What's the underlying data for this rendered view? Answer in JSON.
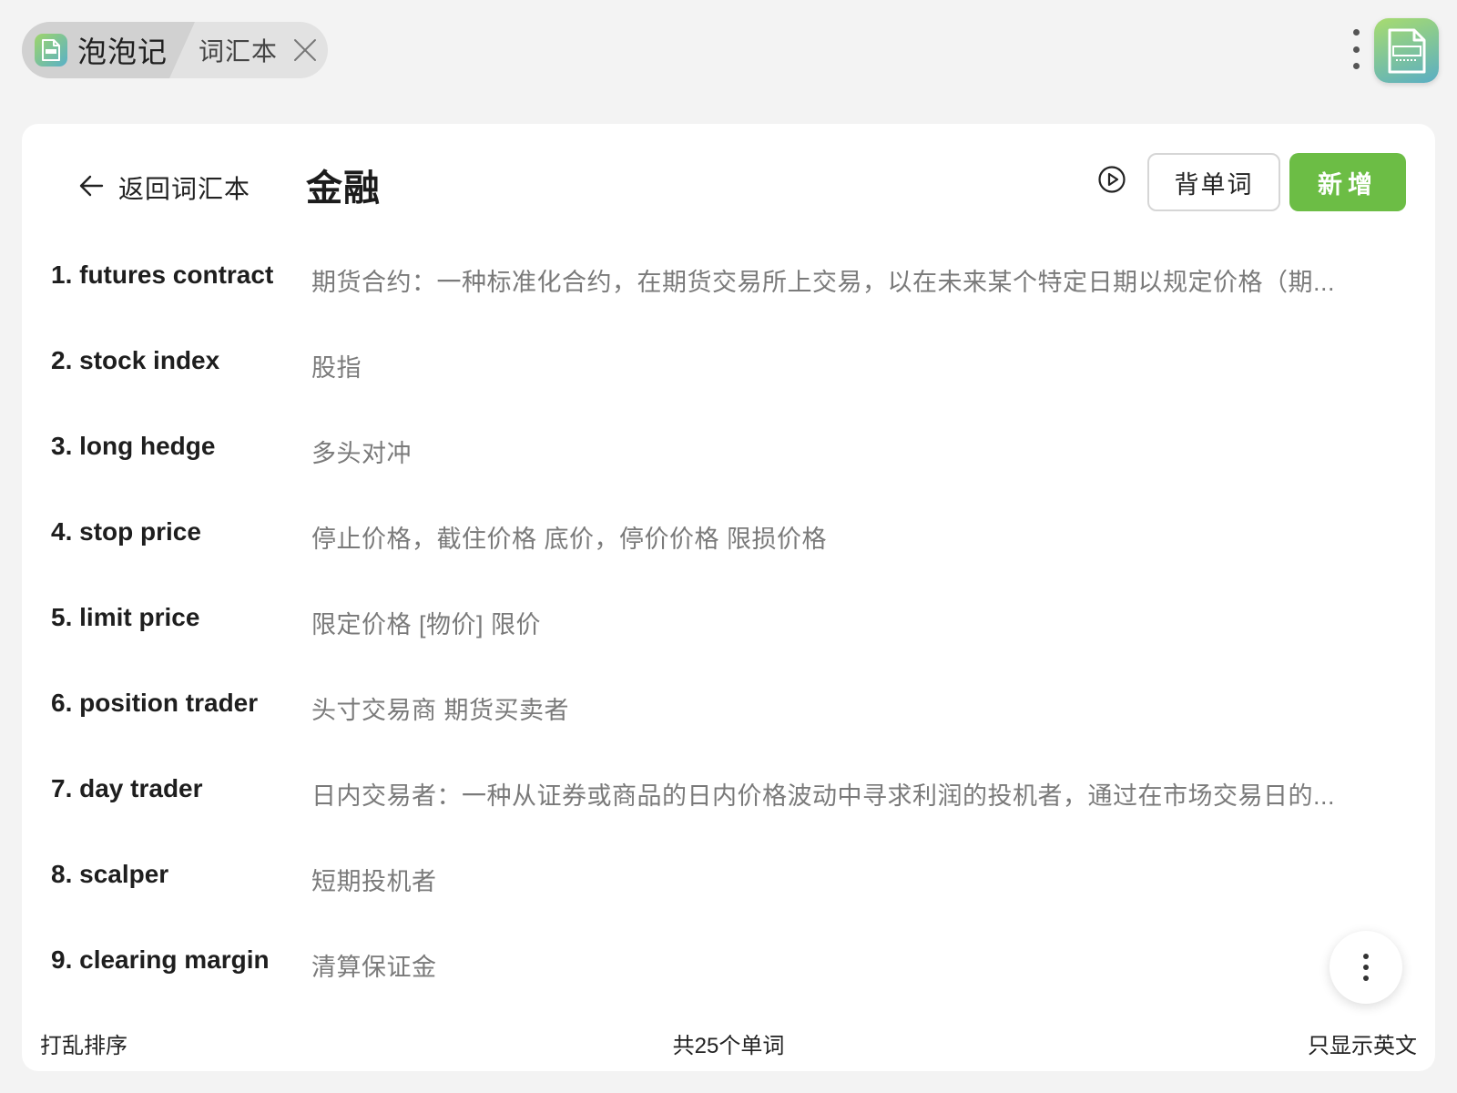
{
  "tabs": {
    "home_label": "泡泡记",
    "vocab_label": "词汇本"
  },
  "icons": {
    "app_icon": "word-doc-icon",
    "close": "close-icon",
    "menu": "more-vertical-icon",
    "back": "arrow-left-icon",
    "play": "play-circle-icon"
  },
  "header": {
    "back_label": "返回词汇本",
    "title": "金融",
    "study_label": "背单词",
    "add_label": "新增"
  },
  "words": [
    {
      "term": "1. futures contract",
      "definition": "期货合约：一种标准化合约，在期货交易所上交易，以在未来某个特定日期以规定价格（期..."
    },
    {
      "term": "2. stock index",
      "definition": "股指"
    },
    {
      "term": "3. long hedge",
      "definition": "多头对冲"
    },
    {
      "term": "4. stop price",
      "definition": "停止价格，截住价格 底价，停价价格 限损价格"
    },
    {
      "term": "5. limit price",
      "definition": "限定价格 [物价] 限价"
    },
    {
      "term": "6. position trader",
      "definition": "头寸交易商 期货买卖者"
    },
    {
      "term": "7. day trader",
      "definition": "日内交易者：一种从证券或商品的日内价格波动中寻求利润的投机者，通过在市场交易日的..."
    },
    {
      "term": "8. scalper",
      "definition": "短期投机者"
    },
    {
      "term": "9. clearing margin",
      "definition": "清算保证金"
    }
  ],
  "footer": {
    "shuffle_label": "打乱排序",
    "count_text": "共25个单词",
    "english_only_label": "只显示英文"
  },
  "colors": {
    "accent": "#6cbd45",
    "background": "#f3f3f3",
    "card": "#ffffff"
  }
}
